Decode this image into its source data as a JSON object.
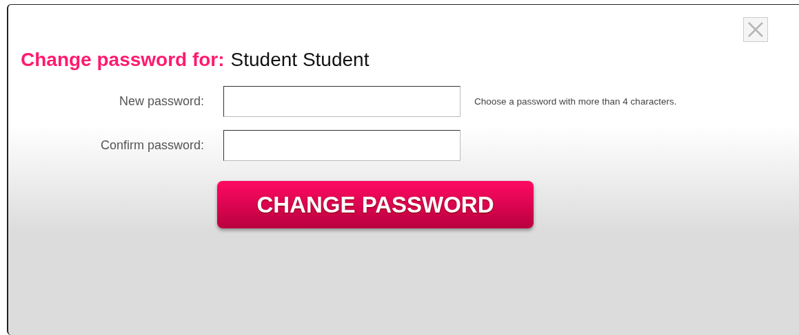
{
  "dialog": {
    "title_label": "Change password for:",
    "title_name": "Student Student",
    "fields": [
      {
        "label": "New password:",
        "hint": "Choose a password with more than 4 characters."
      },
      {
        "label": "Confirm password:"
      }
    ],
    "button": "CHANGE PASSWORD"
  }
}
